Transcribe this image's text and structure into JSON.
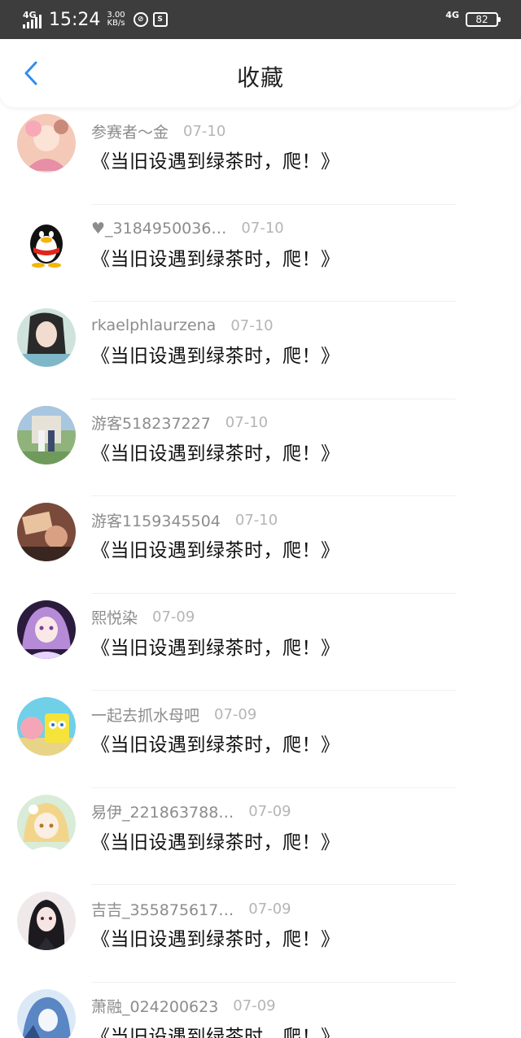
{
  "status_bar": {
    "network_left": "4G",
    "time": "15:24",
    "speed_value": "3.00",
    "speed_unit": "KB/s",
    "network_right": "4G",
    "battery": "82"
  },
  "header": {
    "title": "收藏"
  },
  "colors": {
    "accent": "#2f8ef4",
    "username": "#8c8c8c",
    "date": "#b5b5b5",
    "title_text": "#111111"
  },
  "favorites": [
    {
      "user": "参赛者～金",
      "date": "07-10",
      "title": "《当旧设遇到绿茶时，爬！》",
      "avatar": "anime-girl-pink-avatar"
    },
    {
      "user": "♥_3184950036…",
      "date": "07-10",
      "title": "《当旧设遇到绿茶时，爬！》",
      "avatar": "qq-penguin-avatar"
    },
    {
      "user": "rkaelphlaurzena",
      "date": "07-10",
      "title": "《当旧设遇到绿茶时，爬！》",
      "avatar": "photo-girl-avatar"
    },
    {
      "user": "游客518237227",
      "date": "07-10",
      "title": "《当旧设遇到绿茶时，爬！》",
      "avatar": "outdoor-couple-avatar"
    },
    {
      "user": "游客1159345504",
      "date": "07-10",
      "title": "《当旧设遇到绿茶时，爬！》",
      "avatar": "birthday-photo-avatar"
    },
    {
      "user": "熙悦染",
      "date": "07-09",
      "title": "《当旧设遇到绿茶时，爬！》",
      "avatar": "anime-purple-avatar"
    },
    {
      "user": "一起去抓水母吧",
      "date": "07-09",
      "title": "《当旧设遇到绿茶时，爬！》",
      "avatar": "spongebob-avatar"
    },
    {
      "user": "易伊_221863788…",
      "date": "07-09",
      "title": "《当旧设遇到绿茶时，爬！》",
      "avatar": "anime-blonde-avatar"
    },
    {
      "user": "吉吉_355875617…",
      "date": "07-09",
      "title": "《当旧设遇到绿茶时，爬！》",
      "avatar": "anime-dark-hair-avatar"
    },
    {
      "user": "萧融_024200623",
      "date": "07-09",
      "title": "《当旧设遇到绿茶时，爬！》",
      "avatar": "anime-blue-avatar"
    }
  ]
}
